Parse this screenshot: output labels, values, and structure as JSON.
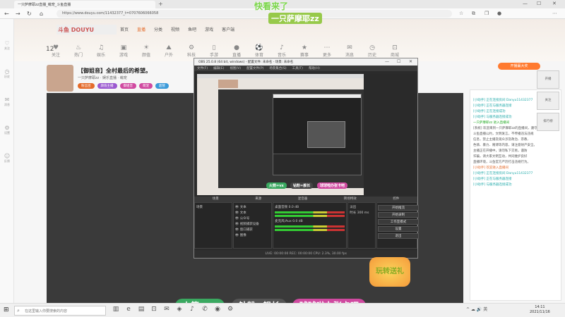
{
  "browser": {
    "tab_title": "一只萨摩耶zz直播_萌宠_斗鱼直播",
    "url": "https://www.douyu.com/11432377_t=0707606066058"
  },
  "rail": [
    "关注",
    "历史",
    "消息",
    "设置",
    "反馈"
  ],
  "site": {
    "nav": [
      "首页",
      "直播",
      "分类",
      "视频",
      "鱼吧",
      "游戏",
      "客户端"
    ],
    "nav_active": 1,
    "follow_count": "12",
    "categories": [
      "关注",
      "热门",
      "娱乐",
      "游戏",
      "颜值",
      "户外",
      "科技",
      "手游",
      "直播",
      "体育",
      "音乐",
      "赛事",
      "更多",
      "消息",
      "历史",
      "商城"
    ],
    "header_button": "开播赢大奖"
  },
  "overlay_name": {
    "top": "快看来了",
    "main": "一只萨摩耶zz"
  },
  "room": {
    "title": "【御姐音】全村最后的希望。",
    "subtitle": "一只萨摩耶zz  ·  娱乐直播  ·  萌宠",
    "badges": [
      {
        "label": "粉丝团",
        "color": "#e46b2a"
      },
      {
        "label": "颜值主播",
        "color": "#9b59d0"
      },
      {
        "label": "御姐音",
        "color": "#d04aa0"
      },
      {
        "label": "萌宠",
        "color": "#d04aa0"
      },
      {
        "label": "超管",
        "color": "#3b9ad9"
      }
    ]
  },
  "chat": {
    "lines": [
      {
        "text": "[小助手] 正在连接房间 Danyu11432377",
        "style": "tag"
      },
      {
        "text": "[小助手] 正在与服务器连接",
        "style": "tag"
      },
      {
        "text": "[小助手] 正在连接成功",
        "style": "tag"
      },
      {
        "text": "[小助手] 与服务器连接成功",
        "style": "tag"
      },
      {
        "text": "一只萨摩耶zz 进入直播间",
        "style": "green"
      },
      {
        "text": "[系统] 欢迎来到一只萨摩耶zz的直播间，遵守",
        "style": ""
      },
      {
        "text": "斗鱼直播公约，文明发言，不传播违法违规",
        "style": ""
      },
      {
        "text": "信息，禁止主播及观众涉及政治、宗教、",
        "style": ""
      },
      {
        "text": "色情、暴力、赌博等内容，请注意财产安全。",
        "style": ""
      },
      {
        "text": "主播正在开播中，请勿私下交易，谨防",
        "style": ""
      },
      {
        "text": "诈骗，请大家文明互动，共同维护良好",
        "style": ""
      },
      {
        "text": "直播环境，斗鱼官方严厉打击违规行为。",
        "style": ""
      },
      {
        "text": "[小助手] 欢迎进入直播间",
        "style": "orange"
      },
      {
        "text": "[小助手] 正在连接房间 Danyu11432377",
        "style": "tag"
      },
      {
        "text": "[小助手] 正在与服务器连接",
        "style": "tag"
      },
      {
        "text": "[小助手] 与服务器连接成功",
        "style": "tag"
      }
    ]
  },
  "side_float": [
    "开播",
    "关注",
    "排行榜"
  ],
  "obs": {
    "title": "OBS 25.0.8 (64 bit, windows) - 配置文件: 未命名 - 场景: 未命名",
    "menu": [
      "文件(F)",
      "编辑(E)",
      "视图(V)",
      "配置文件(P)",
      "场景集合(S)",
      "工具(T)",
      "帮助(H)"
    ],
    "dock_labels": [
      "场景",
      "来源",
      "混音器",
      "转场特效",
      "控件"
    ],
    "scenes": [
      "场景"
    ],
    "sources": [
      "文本",
      "文本",
      "公众号",
      "视频捕获设备",
      "窗口捕获",
      "图像"
    ],
    "mixer": [
      {
        "name": "桌面音频",
        "level": "0.0 dB"
      },
      {
        "name": "麦克风/Aux",
        "level": "0.0 dB"
      }
    ],
    "transition": {
      "name": "淡出",
      "duration_label": "时长",
      "duration": "300 ms"
    },
    "controls": [
      "开始推流",
      "开始录制",
      "工作室模式",
      "设置",
      "退出"
    ],
    "status": "LIVE: 00:00:00   REC: 00:00:00   CPU: 2.3%, 30.00 fps"
  },
  "preview_overlays": [
    {
      "text": "火箭=vx",
      "color": "#3aa860"
    },
    {
      "text": "钻粉=舰长",
      "color": "#444"
    },
    {
      "text": "球球啦办张卡吧",
      "color": "#d04aa0"
    }
  ],
  "banners": [
    {
      "text": "火箭=vx",
      "color": "#3aa860"
    },
    {
      "text": "钻粉=舰长",
      "color": "#555"
    },
    {
      "text": "球球啦办张卡吧",
      "color": "#d04aa0"
    }
  ],
  "sticker": "玩转送礼",
  "taskbar": {
    "search_placeholder": "在这里输入你要搜索的内容",
    "apps": [
      "task-view-icon",
      "edge-icon",
      "folder-icon",
      "store-icon",
      "mail-icon",
      "game-icon",
      "music-icon",
      "chat-icon",
      "obs-icon",
      "settings-icon"
    ],
    "tray": "^  ☁  🔊  英",
    "time": "14:11",
    "date": "2021/11/16"
  },
  "colors": {
    "accent": "#e46b2a",
    "obs_bg": "#2b2b2b",
    "video_bg": "#3a3a3a"
  }
}
